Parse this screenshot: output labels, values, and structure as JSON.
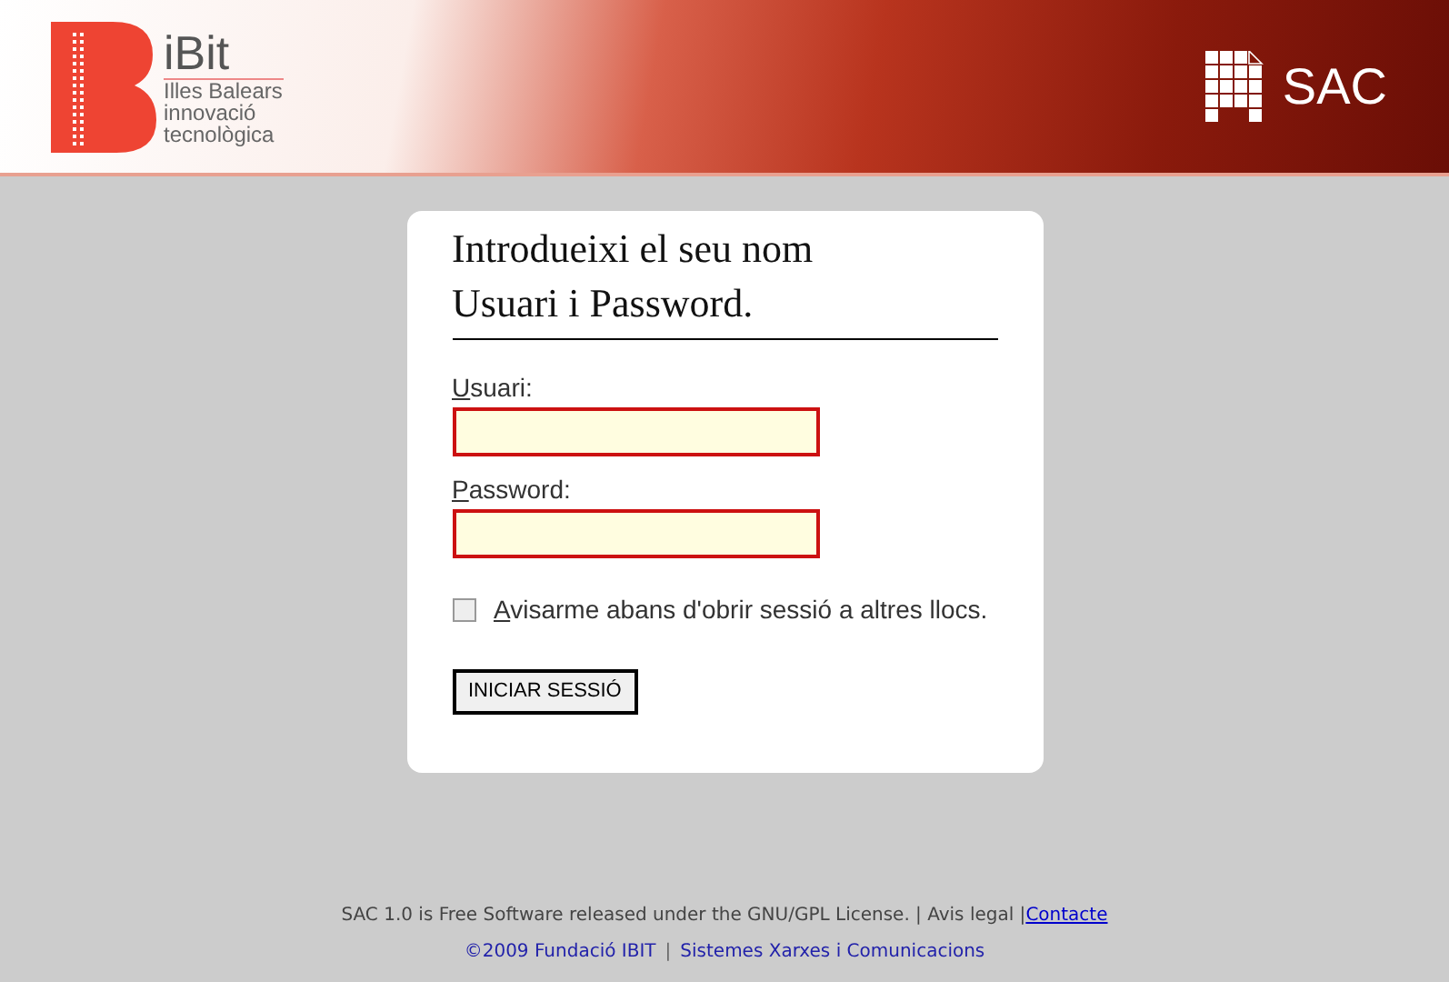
{
  "header": {
    "logo": {
      "name": "iBit",
      "tagline": [
        "Illes Balears",
        "innovació",
        "tecnològica"
      ]
    },
    "app_name": "SAC"
  },
  "login": {
    "title": "Introdueixi el seu nom Usuari i Password.",
    "fields": [
      {
        "label": "Usuari:"
      },
      {
        "label": "Password:"
      }
    ],
    "remember": {
      "label": "Avisarme abans d'obrir sessió a altres llocs.",
      "checked": false
    },
    "submit": "INICIAR SESSIÓ"
  },
  "footer": {
    "line1": "SAC 1.0 is Free Software released under the GNU/GPL License. | Avis legal |",
    "contact_link": "Contacte",
    "links": [
      "©2009 Fundació IBIT",
      "Sistemes Xarxes i Comunicacions"
    ],
    "separator": "|"
  }
}
